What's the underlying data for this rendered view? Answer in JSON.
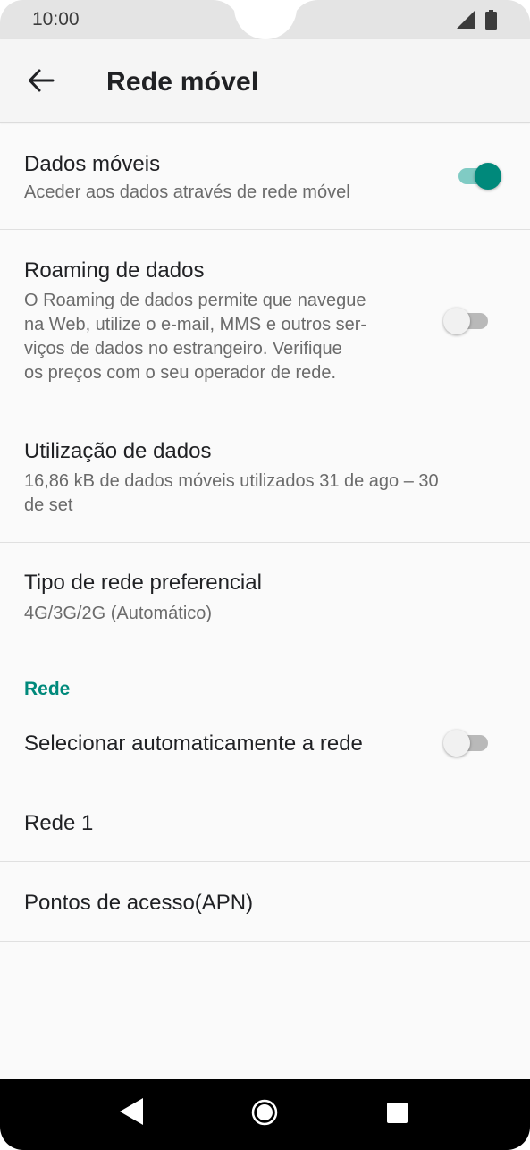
{
  "status_bar": {
    "time": "10:00",
    "icons": [
      "signal-icon",
      "battery-icon"
    ]
  },
  "app_bar": {
    "back_icon": "arrow-back-icon",
    "title": "Rede móvel"
  },
  "settings": [
    {
      "title": "Dados móveis",
      "subtitle": "Aceder aos dados através de rede móvel",
      "toggle": true
    },
    {
      "title": "Roaming de dados",
      "subtitle_lines": [
        "O Roaming de dados permite que navegue",
        "na Web, utilize o e-mail, MMS e outros ser-",
        "viços de dados no estrangeiro. Verifique",
        "os preços com o seu operador de rede."
      ],
      "toggle": false
    },
    {
      "title": "Utilização de dados",
      "subtitle_lines": [
        "16,86 kB de dados móveis utilizados 31 de ago – 30",
        "de set"
      ]
    },
    {
      "title": "Tipo de rede preferencial",
      "subtitle": "4G/3G/2G (Automático)"
    }
  ],
  "section": {
    "label": "Rede",
    "items": [
      {
        "title": "Selecionar automaticamente a rede",
        "toggle": false
      },
      {
        "title": "Rede 1"
      },
      {
        "title": "Pontos de acesso(APN)"
      }
    ]
  },
  "nav_bar": {
    "icons": [
      "nav-back-icon",
      "nav-home-icon",
      "nav-recents-icon"
    ]
  },
  "colors": {
    "accent": "#00897b",
    "accent_track": "#80cbc4",
    "toggle_off_track": "#b9b9b9",
    "background": "#fafafa",
    "status_bar": "#e4e4e4"
  }
}
